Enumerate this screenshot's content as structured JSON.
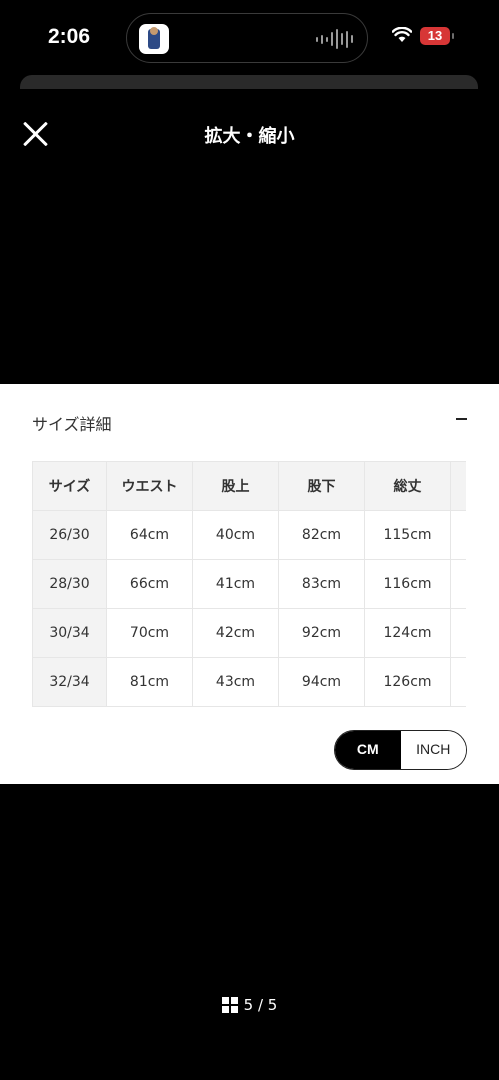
{
  "status_bar": {
    "time": "2:06",
    "battery": "13",
    "battery_color": "#d73636"
  },
  "header": {
    "title": "拡大・縮小",
    "close_icon": "close-icon"
  },
  "size_details": {
    "title": "サイズ詳細",
    "toggle_icon": "minus-icon",
    "columns": [
      "サイズ",
      "ウエスト",
      "股上",
      "股下",
      "総丈",
      ""
    ],
    "rows": [
      [
        "26/30",
        "64cm",
        "40cm",
        "82cm",
        "115cm",
        ""
      ],
      [
        "28/30",
        "66cm",
        "41cm",
        "83cm",
        "116cm",
        ""
      ],
      [
        "30/34",
        "70cm",
        "42cm",
        "92cm",
        "124cm",
        ""
      ],
      [
        "32/34",
        "81cm",
        "43cm",
        "94cm",
        "126cm",
        ""
      ]
    ],
    "units": {
      "cm": "CM",
      "inch": "INCH",
      "selected": "CM"
    }
  },
  "pager": {
    "icon": "grid-icon",
    "text": "5 / 5"
  }
}
